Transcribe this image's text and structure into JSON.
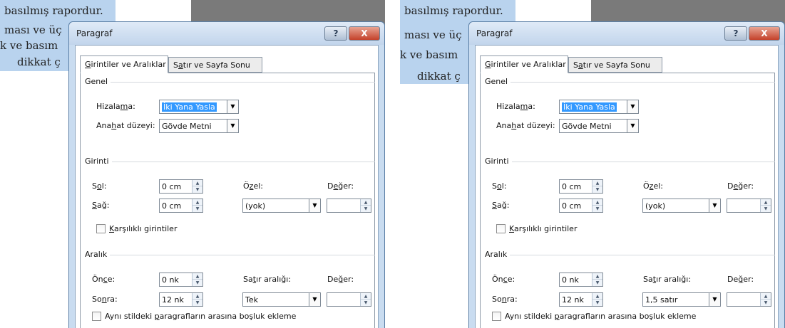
{
  "document": {
    "lines": [
      "basılmış rapordur.",
      "ması ve üç",
      "k ve basım",
      "dikkat ç"
    ]
  },
  "dialog": {
    "title": "Paragraf",
    "help": "?",
    "close": "X",
    "tabs": [
      {
        "label": "Girintiler ve Aralıklar",
        "u": "G",
        "rest": "irintiler ve Aralıklar"
      },
      {
        "label": "Satır ve Sayfa Sonu",
        "pre": "S",
        "u": "a",
        "rest": "tır ve Sayfa Sonu"
      }
    ],
    "genel": {
      "section": "Genel",
      "hizalama_label": {
        "pre": "Hizala",
        "u": "m",
        "rest": "a:"
      },
      "hizalama_value": "İki Yana Yasla",
      "anahat_label": {
        "pre": "Ana",
        "u": "h",
        "rest": "at düzeyi:"
      },
      "anahat_value": "Gövde Metni"
    },
    "girinti": {
      "section": "Girinti",
      "sol_label": {
        "pre": "S",
        "u": "o",
        "rest": "l:"
      },
      "sol_value": "0 cm",
      "sag_label": {
        "pre": "",
        "u": "S",
        "rest": "ağ:"
      },
      "sag_value": "0 cm",
      "ozel_label": {
        "pre": "Ö",
        "u": "z",
        "rest": "el:"
      },
      "ozel_value": "(yok)",
      "deger_label": {
        "pre": "D",
        "u": "e",
        "rest": "ğer:"
      },
      "deger_value": "",
      "karsilikli": {
        "pre": "",
        "u": "K",
        "rest": "arşılıklı girintiler"
      }
    },
    "aralik": {
      "section": "Aralık",
      "once_label": {
        "pre": "Ön",
        "u": "c",
        "rest": "e:"
      },
      "once_value": "0 nk",
      "sonra_label": {
        "pre": "So",
        "u": "n",
        "rest": "ra:"
      },
      "sonra_value": "12 nk",
      "satir_label": {
        "pre": "Sa",
        "u": "t",
        "rest": "ır aralığı:"
      },
      "deger_label": {
        "pre": "De",
        "u": "ğ",
        "rest": "er:"
      },
      "deger_value": "",
      "ayni_stil": {
        "pre": "Aynı stildeki ",
        "u": "p",
        "rest": "aragrafların arasına boşluk ekleme"
      }
    }
  },
  "panels": {
    "left": {
      "satir_value": "Tek"
    },
    "right": {
      "satir_value": "1,5 satır"
    }
  }
}
